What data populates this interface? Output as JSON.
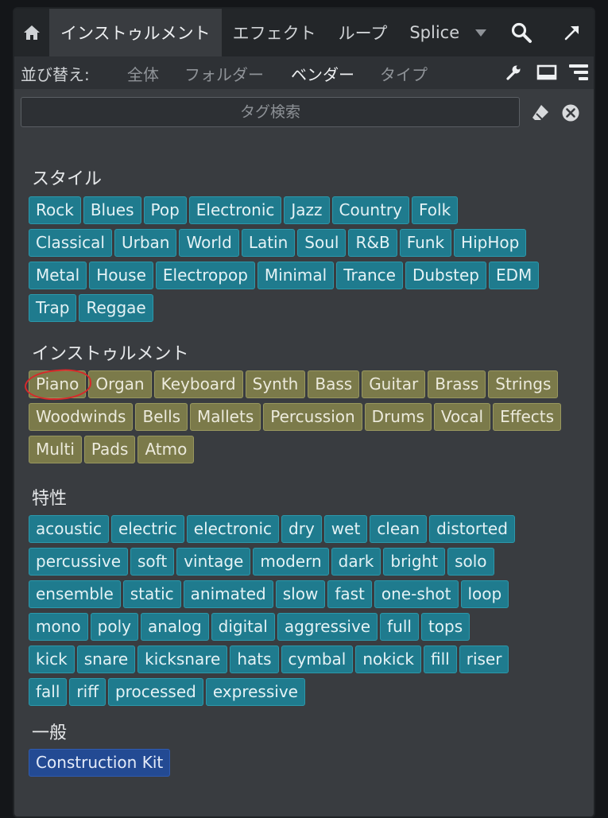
{
  "tabs": {
    "items": [
      {
        "label": "インストゥルメント",
        "active": true
      },
      {
        "label": "エフェクト",
        "active": false
      },
      {
        "label": "ループ",
        "active": false
      },
      {
        "label": "Splice",
        "active": false
      }
    ],
    "icons": [
      "home-icon",
      "chevron-down-icon",
      "search-icon",
      "expand-arrow-icon"
    ]
  },
  "sort": {
    "label": "並び替え:",
    "options": [
      {
        "label": "全体",
        "active": false
      },
      {
        "label": "フォルダー",
        "active": false
      },
      {
        "label": "ベンダー",
        "active": true
      },
      {
        "label": "タイプ",
        "active": false
      }
    ],
    "icons": [
      "wrench-icon",
      "window-icon",
      "list-view-icon"
    ]
  },
  "search": {
    "placeholder": "タグ検索",
    "value": "",
    "icons": [
      "eraser-icon",
      "clear-icon"
    ]
  },
  "sections": {
    "style": {
      "title": "スタイル",
      "color": "#1f7b8e",
      "tags": [
        [
          "Rock",
          "Blues",
          "Pop",
          "Electronic",
          "Jazz",
          "Country",
          "Folk"
        ],
        [
          "Classical",
          "Urban",
          "World",
          "Latin",
          "Soul",
          "R&B",
          "Funk",
          "HipHop"
        ],
        [
          "Metal",
          "House",
          "Electropop",
          "Minimal",
          "Trance",
          "Dubstep",
          "EDM"
        ],
        [
          "Trap",
          "Reggae"
        ]
      ]
    },
    "instrument": {
      "title": "インストゥルメント",
      "color": "#7b7a4a",
      "highlighted": "Piano",
      "tags": [
        [
          "Piano",
          "Organ",
          "Keyboard",
          "Synth",
          "Bass",
          "Guitar",
          "Brass",
          "Strings"
        ],
        [
          "Woodwinds",
          "Bells",
          "Mallets",
          "Percussion",
          "Drums",
          "Vocal",
          "Effects"
        ],
        [
          "Multi",
          "Pads",
          "Atmo"
        ]
      ]
    },
    "character": {
      "title": "特性",
      "color": "#1f7b8e",
      "tags": [
        [
          "acoustic",
          "electric",
          "electronic",
          "dry",
          "wet",
          "clean",
          "distorted"
        ],
        [
          "percussive",
          "soft",
          "vintage",
          "modern",
          "dark",
          "bright",
          "solo"
        ],
        [
          "ensemble",
          "static",
          "animated",
          "slow",
          "fast",
          "one-shot",
          "loop"
        ],
        [
          "mono",
          "poly",
          "analog",
          "digital",
          "aggressive",
          "full",
          "tops"
        ],
        [
          "kick",
          "snare",
          "kicksnare",
          "hats",
          "cymbal",
          "nokick",
          "fill",
          "riser"
        ],
        [
          "fall",
          "riff",
          "processed",
          "expressive"
        ]
      ]
    },
    "general": {
      "title": "一般",
      "color": "#234a93",
      "tags": [
        [
          "Construction Kit"
        ]
      ]
    }
  },
  "colors": {
    "panel": "#393c40",
    "tabbar": "#232629",
    "highlight_circle": "#d8282a"
  }
}
